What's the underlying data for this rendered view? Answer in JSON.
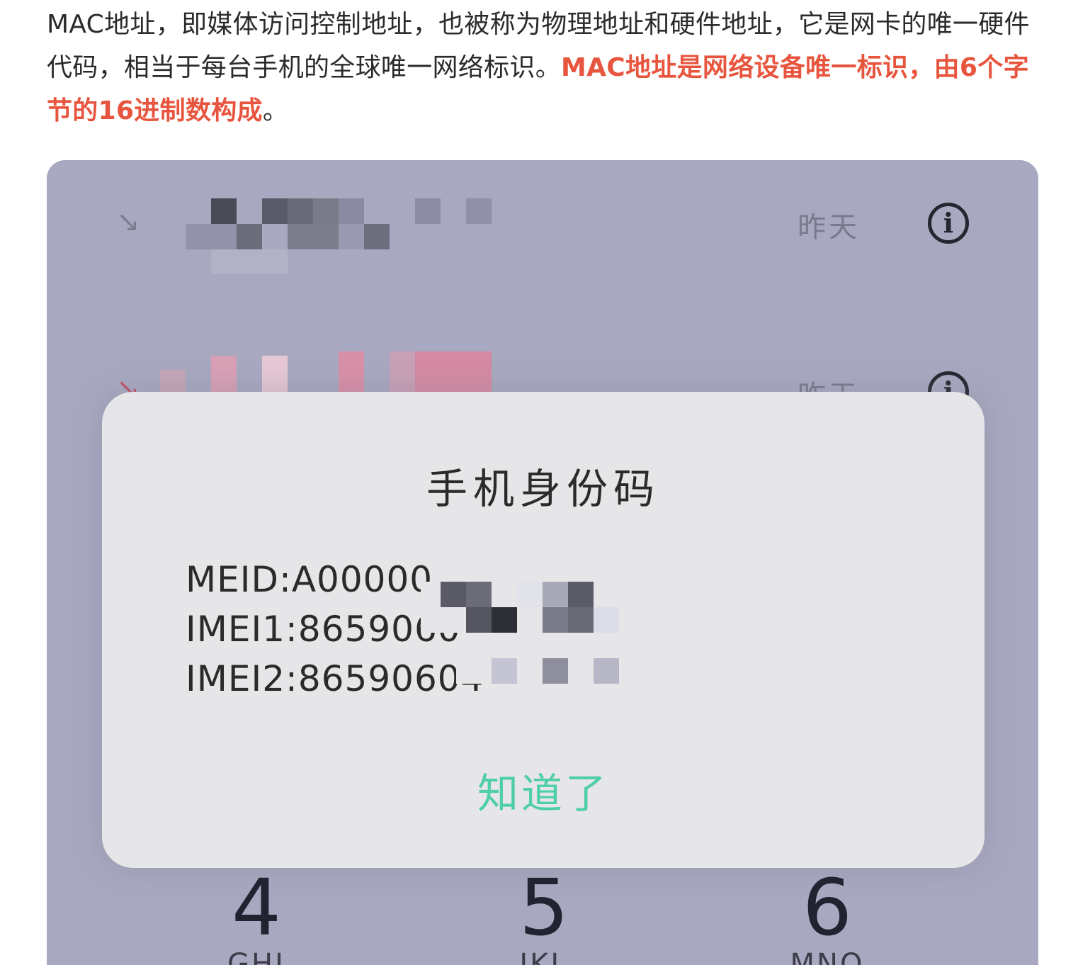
{
  "article": {
    "text_normal": "MAC地址，即媒体访问控制地址，也被称为物理地址和硬件地址，它是网卡的唯一硬件代码，相当于每台手机的全球唯一网络标识。",
    "text_highlight": "MAC地址是网络设备唯一标识，由6个字节的16进制数构成",
    "text_end": "。",
    "highlight_color": "#e8553e"
  },
  "screenshot": {
    "calls": [
      {
        "arrow": "↘",
        "time": "昨天",
        "info": "i"
      },
      {
        "arrow": "↘",
        "time": "昨天",
        "info": "i"
      }
    ],
    "dialog": {
      "title": "手机身份码",
      "lines": [
        "MEID:A00000",
        "IMEI1:8659060",
        "IMEI2:86590604"
      ],
      "confirm": "知道了",
      "confirm_color": "#4fcfa6"
    },
    "keypad": [
      {
        "num": "4",
        "letters": "GHI"
      },
      {
        "num": "5",
        "letters": "JKL"
      },
      {
        "num": "6",
        "letters": "MNO"
      }
    ]
  }
}
